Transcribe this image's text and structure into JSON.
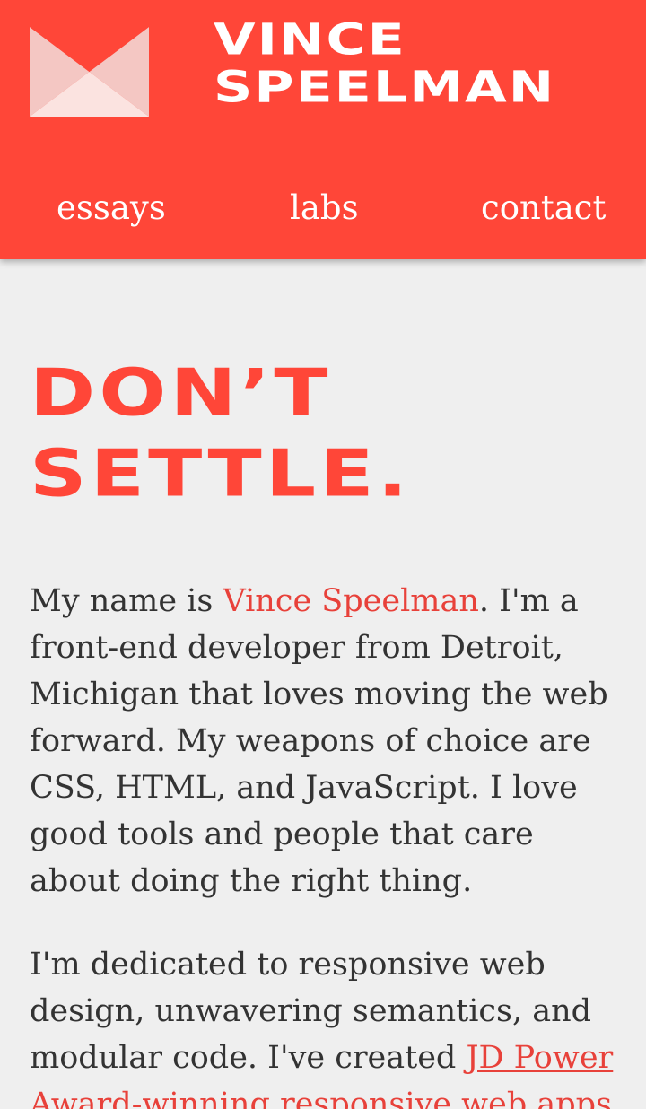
{
  "header": {
    "logo": {
      "icon": "envelope-logo-icon"
    },
    "wordmark": {
      "line1": "VINCE",
      "line2": "SPEELMAN"
    },
    "nav": [
      {
        "label": "essays"
      },
      {
        "label": "labs"
      },
      {
        "label": "contact"
      }
    ]
  },
  "main": {
    "headline": {
      "line1": "DON’T",
      "line2": "SETTLE."
    },
    "intro": {
      "l1_a": "My name is ",
      "name_link": "Vince Speelman",
      "l1_b": ". I'm a",
      "l2": "front-end developer from Detroit,",
      "l3": "Michigan that loves moving the web",
      "l4": "forward. My weapons of choice are",
      "l5": "CSS, HTML, and JavaScript. I love",
      "l6": "good tools and people that care",
      "l7": "about doing the right thing."
    },
    "second": {
      "l1": "I'm dedicated to responsive web",
      "l2": "design, unwavering semantics, and",
      "l3_a": "modular code. I've created ",
      "l3_link": "JD Power",
      "l4_link": "Award-winning responsive web apps"
    }
  },
  "colors": {
    "brand_red": "#ff4638",
    "link_red": "#e8413a",
    "background": "#efefef",
    "text": "#333333",
    "white": "#ffffff"
  }
}
